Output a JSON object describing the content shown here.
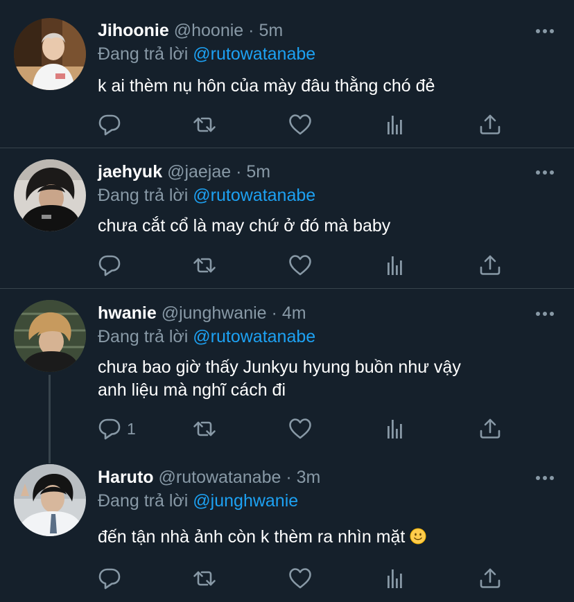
{
  "tweets": [
    {
      "name": "Jihoonie",
      "handle": "@hoonie",
      "separator": "·",
      "time": "5m",
      "replying_label": "Đang trả lời",
      "replying_to": "@rutowatanabe",
      "lines": [
        "k ai thèm nụ hôn của mày đâu thằng chó đẻ"
      ],
      "reply_count": ""
    },
    {
      "name": "jaehyuk",
      "handle": "@jaejae",
      "separator": "·",
      "time": "5m",
      "replying_label": "Đang trả lời",
      "replying_to": "@rutowatanabe",
      "lines": [
        "chưa cắt cổ là may chứ ở đó mà baby"
      ],
      "reply_count": ""
    },
    {
      "name": "hwanie",
      "handle": "@junghwanie",
      "separator": "·",
      "time": "4m",
      "replying_label": "Đang trả lời",
      "replying_to": "@rutowatanabe",
      "lines": [
        "chưa bao giờ thấy Junkyu hyung buồn như vậy",
        "anh liệu mà nghĩ cách đi"
      ],
      "reply_count": "1"
    },
    {
      "name": "Haruto",
      "handle": "@rutowatanabe",
      "separator": "·",
      "time": "3m",
      "replying_label": "Đang trả lời",
      "replying_to": "@junghwanie",
      "lines": [
        "đến tận nhà ảnh còn k thèm ra nhìn mặt"
      ],
      "emoji": "slightly-smiling-face",
      "reply_count": ""
    }
  ],
  "colors": {
    "background": "#15202b",
    "text": "#ffffff",
    "secondary": "#8899a6",
    "link": "#1da1f2",
    "divider": "#38444d"
  },
  "icons": [
    "reply-icon",
    "retweet-icon",
    "like-icon",
    "analytics-icon",
    "share-icon",
    "more-icon"
  ]
}
